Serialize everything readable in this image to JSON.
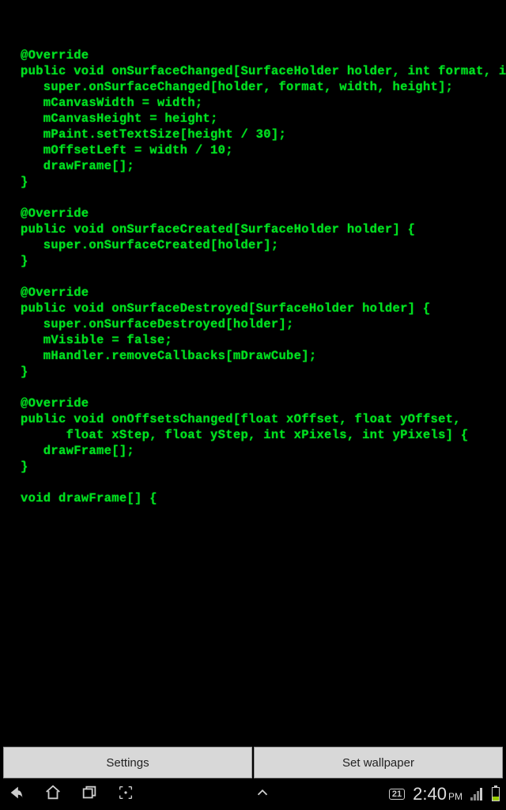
{
  "code": {
    "lines": [
      "@Override",
      "public void onSurfaceChanged[SurfaceHolder holder, int format, int width, i",
      "   super.onSurfaceChanged[holder, format, width, height];",
      "   mCanvasWidth = width;",
      "   mCanvasHeight = height;",
      "   mPaint.setTextSize[height / 30];",
      "   mOffsetLeft = width / 10;",
      "   drawFrame[];",
      "}",
      "",
      "@Override",
      "public void onSurfaceCreated[SurfaceHolder holder] {",
      "   super.onSurfaceCreated[holder];",
      "}",
      "",
      "@Override",
      "public void onSurfaceDestroyed[SurfaceHolder holder] {",
      "   super.onSurfaceDestroyed[holder];",
      "   mVisible = false;",
      "   mHandler.removeCallbacks[mDrawCube];",
      "}",
      "",
      "@Override",
      "public void onOffsetsChanged[float xOffset, float yOffset,",
      "      float xStep, float yStep, int xPixels, int yPixels] {",
      "   drawFrame[];",
      "}",
      "",
      "void drawFrame[] {"
    ]
  },
  "buttons": {
    "settings": "Settings",
    "setWallpaper": "Set wallpaper"
  },
  "statusbar": {
    "date": "21",
    "time": "2:40",
    "ampm": "PM"
  }
}
